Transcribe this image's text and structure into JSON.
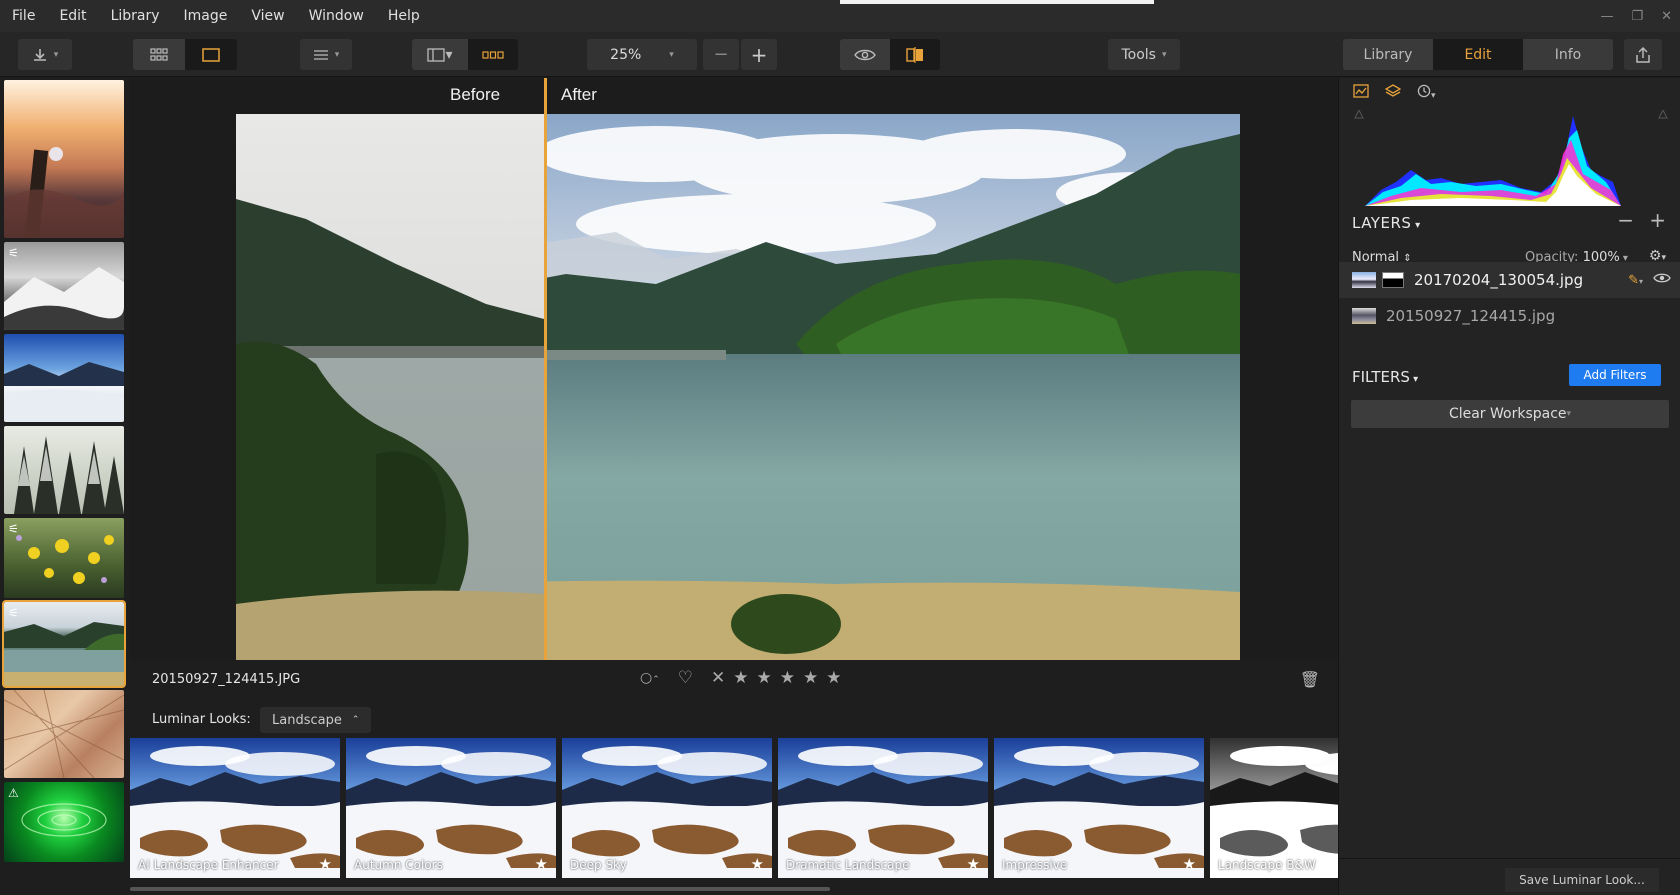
{
  "menu": [
    "File",
    "Edit",
    "Library",
    "Image",
    "View",
    "Window",
    "Help"
  ],
  "toolbar": {
    "import_icon": "download-icon",
    "zoom": "25%",
    "zoom_minus": "−",
    "zoom_plus": "+",
    "tools": "Tools",
    "tabs": [
      "Library",
      "Edit",
      "Info"
    ],
    "active_tab": "Edit"
  },
  "viewer": {
    "before_label": "Before",
    "after_label": "After"
  },
  "info": {
    "filename": "20150927_124415.JPG"
  },
  "looks": {
    "label": "Luminar Looks:",
    "category": "Landscape",
    "items": [
      {
        "name": "AI Landscape Enhancer",
        "bw": false
      },
      {
        "name": "Autumn Colors",
        "bw": false
      },
      {
        "name": "Deep Sky",
        "bw": false
      },
      {
        "name": "Dramatic Landscape",
        "bw": false
      },
      {
        "name": "Impressive",
        "bw": false
      },
      {
        "name": "Landscape B&W",
        "bw": true
      }
    ]
  },
  "panel": {
    "layers_title": "LAYERS",
    "blend_mode": "Normal",
    "opacity_label": "Opacity:",
    "opacity_value": "100%",
    "layers": [
      {
        "name": "20170204_130054.jpg",
        "active": true
      },
      {
        "name": "20150927_124415.jpg",
        "active": false
      }
    ],
    "filters_title": "FILTERS",
    "add_filters": "Add Filters",
    "clear_workspace": "Clear Workspace",
    "save_look": "Save Luminar Look..."
  },
  "colors": {
    "accent": "#e8a33b",
    "button_blue": "#1e7bf0"
  }
}
